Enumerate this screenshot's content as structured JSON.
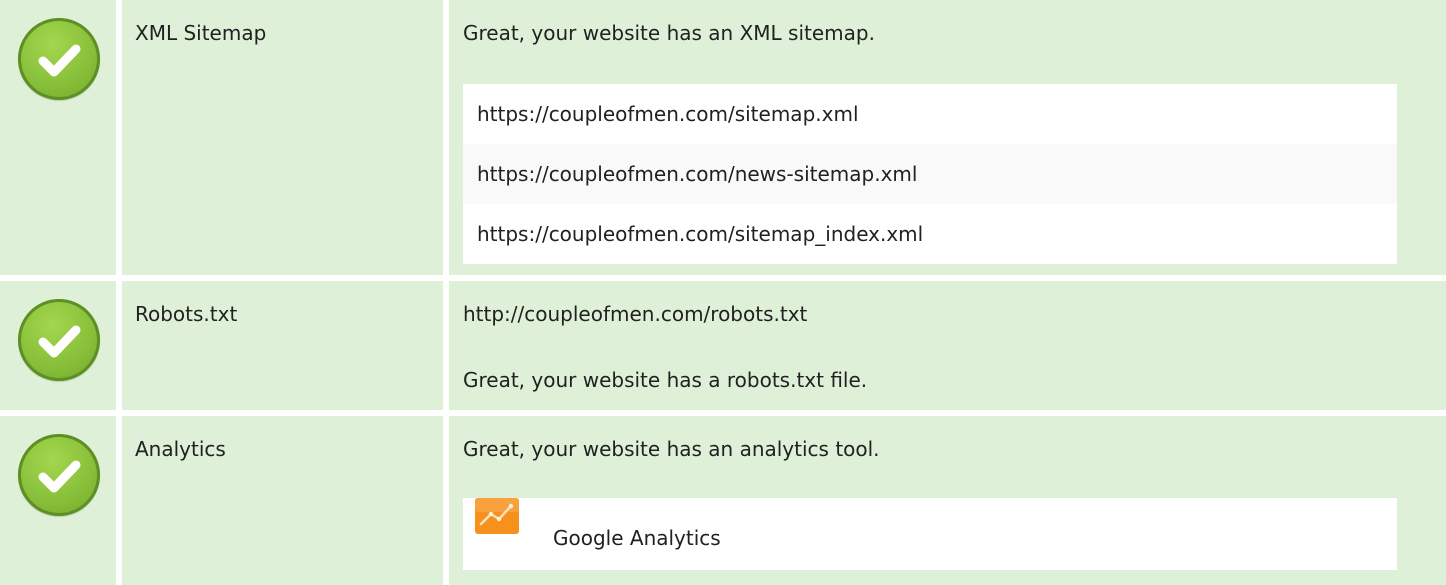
{
  "sections": [
    {
      "label": "XML Sitemap",
      "message": "Great, your website has an XML sitemap.",
      "status_icon": "check-icon",
      "sitemaps": [
        "https://coupleofmen.com/sitemap.xml",
        "https://coupleofmen.com/news-sitemap.xml",
        "https://coupleofmen.com/sitemap_index.xml"
      ]
    },
    {
      "label": "Robots.txt",
      "url": "http://coupleofmen.com/robots.txt",
      "message": "Great, your website has a robots.txt file.",
      "status_icon": "check-icon"
    },
    {
      "label": "Analytics",
      "message": "Great, your website has an analytics tool.",
      "status_icon": "check-icon",
      "tools": [
        {
          "name": "Google Analytics",
          "icon": "google-analytics-icon"
        }
      ]
    }
  ],
  "colors": {
    "row_background": "#dff0d8",
    "check_green": "#88c03a",
    "analytics_orange": "#f7911e"
  }
}
